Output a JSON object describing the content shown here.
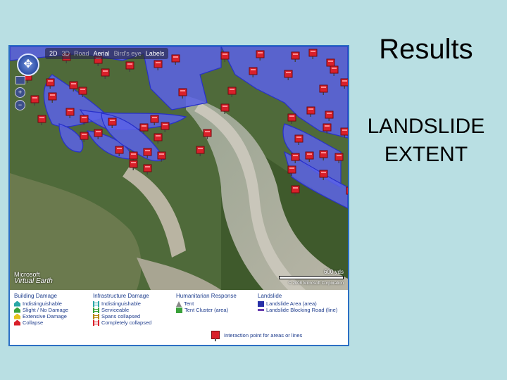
{
  "slide": {
    "title": "Results",
    "body_line1": "LANDSLIDE",
    "body_line2": "EXTENT"
  },
  "map": {
    "toolbar": [
      {
        "label": "2D",
        "state": "active"
      },
      {
        "label": "3D",
        "state": "inactive"
      },
      {
        "label": "Road",
        "state": "inactive"
      },
      {
        "label": "Aerial",
        "state": "active"
      },
      {
        "label": "Bird's eye",
        "state": "inactive"
      },
      {
        "label": "Labels",
        "state": "active"
      }
    ],
    "zoom_in": "+",
    "zoom_out": "−",
    "logo_line1": "Microsoft",
    "logo_line2": "Virtual Earth",
    "scale_label": "600 yds",
    "copyright": "© 2008 Microsoft Corporation",
    "colors": {
      "landslide_fill": "#5b62e8",
      "landslide_stroke": "#2730c8",
      "marker": "#d9202a",
      "frame": "#2b6fc4"
    }
  },
  "legend": {
    "building": {
      "title": "Building Damage",
      "items": [
        {
          "label": "Indistinguishable",
          "color": "#2aa7a7"
        },
        {
          "label": "Slight / No Damage",
          "color": "#3aa13a"
        },
        {
          "label": "Extensive Damage",
          "color": "#e6c21a"
        },
        {
          "label": "Collapse",
          "color": "#d9202a"
        }
      ]
    },
    "infrastructure": {
      "title": "Infrastructure Damage",
      "items": [
        {
          "label": "Indistinguishable",
          "color": "#2aa7a7"
        },
        {
          "label": "Serviceable",
          "color": "#3aa13a"
        },
        {
          "label": "Spans collapsed",
          "color": "#b8860b"
        },
        {
          "label": "Completely collapsed",
          "color": "#d9202a"
        }
      ]
    },
    "humanitarian": {
      "title": "Humanitarian Response",
      "items": [
        {
          "label": "Tent",
          "color": "#9a9a9a"
        },
        {
          "label": "Tent Cluster (area)",
          "color": "#3aa13a"
        }
      ]
    },
    "landslide": {
      "title": "Landslide",
      "items": [
        {
          "label": "Landslide Area (area)",
          "color": "#2730a8"
        },
        {
          "label": "Landslide Blocking Road (line)",
          "color": "#6a3fb0"
        }
      ]
    },
    "interaction_label": "Interaction point for areas or lines"
  }
}
